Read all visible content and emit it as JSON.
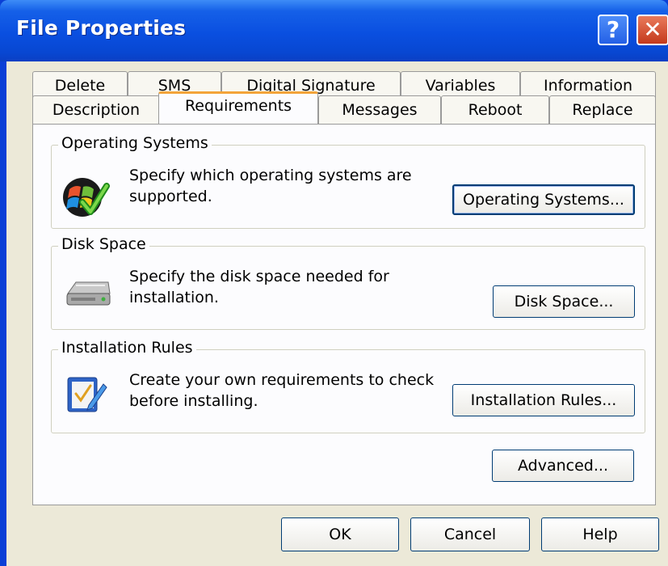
{
  "window": {
    "title": "File Properties"
  },
  "titlebar": {
    "help_glyph": "?",
    "close_glyph": "✕"
  },
  "tabs": {
    "row1": [
      {
        "label": "Delete"
      },
      {
        "label": "SMS"
      },
      {
        "label": "Digital Signature"
      },
      {
        "label": "Variables"
      },
      {
        "label": "Information"
      }
    ],
    "row2": [
      {
        "label": "Description"
      },
      {
        "label": "Requirements",
        "active": true
      },
      {
        "label": "Messages"
      },
      {
        "label": "Reboot"
      },
      {
        "label": "Replace"
      }
    ]
  },
  "groups": {
    "os": {
      "label": "Operating Systems",
      "description": "Specify which operating systems are supported.",
      "line1": "Specify which operating systems are",
      "line2": "supported.",
      "button": "Operating Systems...",
      "icon": "windows-check-icon"
    },
    "disk": {
      "label": "Disk Space",
      "line1": "Specify the disk space needed for",
      "line2": "installation.",
      "button": "Disk Space...",
      "icon": "hard-drive-icon"
    },
    "rules": {
      "label": "Installation Rules",
      "line1": "Create your own requirements to check",
      "line2": "before installing.",
      "button": "Installation Rules...",
      "icon": "checklist-pen-icon"
    }
  },
  "advanced_button": "Advanced...",
  "footer": {
    "ok": "OK",
    "cancel": "Cancel",
    "help": "Help"
  },
  "colors": {
    "titlebar": "#0a4fe0",
    "face": "#ece9d8",
    "active_tab_accent": "#f3a43a",
    "close": "#c4391c"
  }
}
